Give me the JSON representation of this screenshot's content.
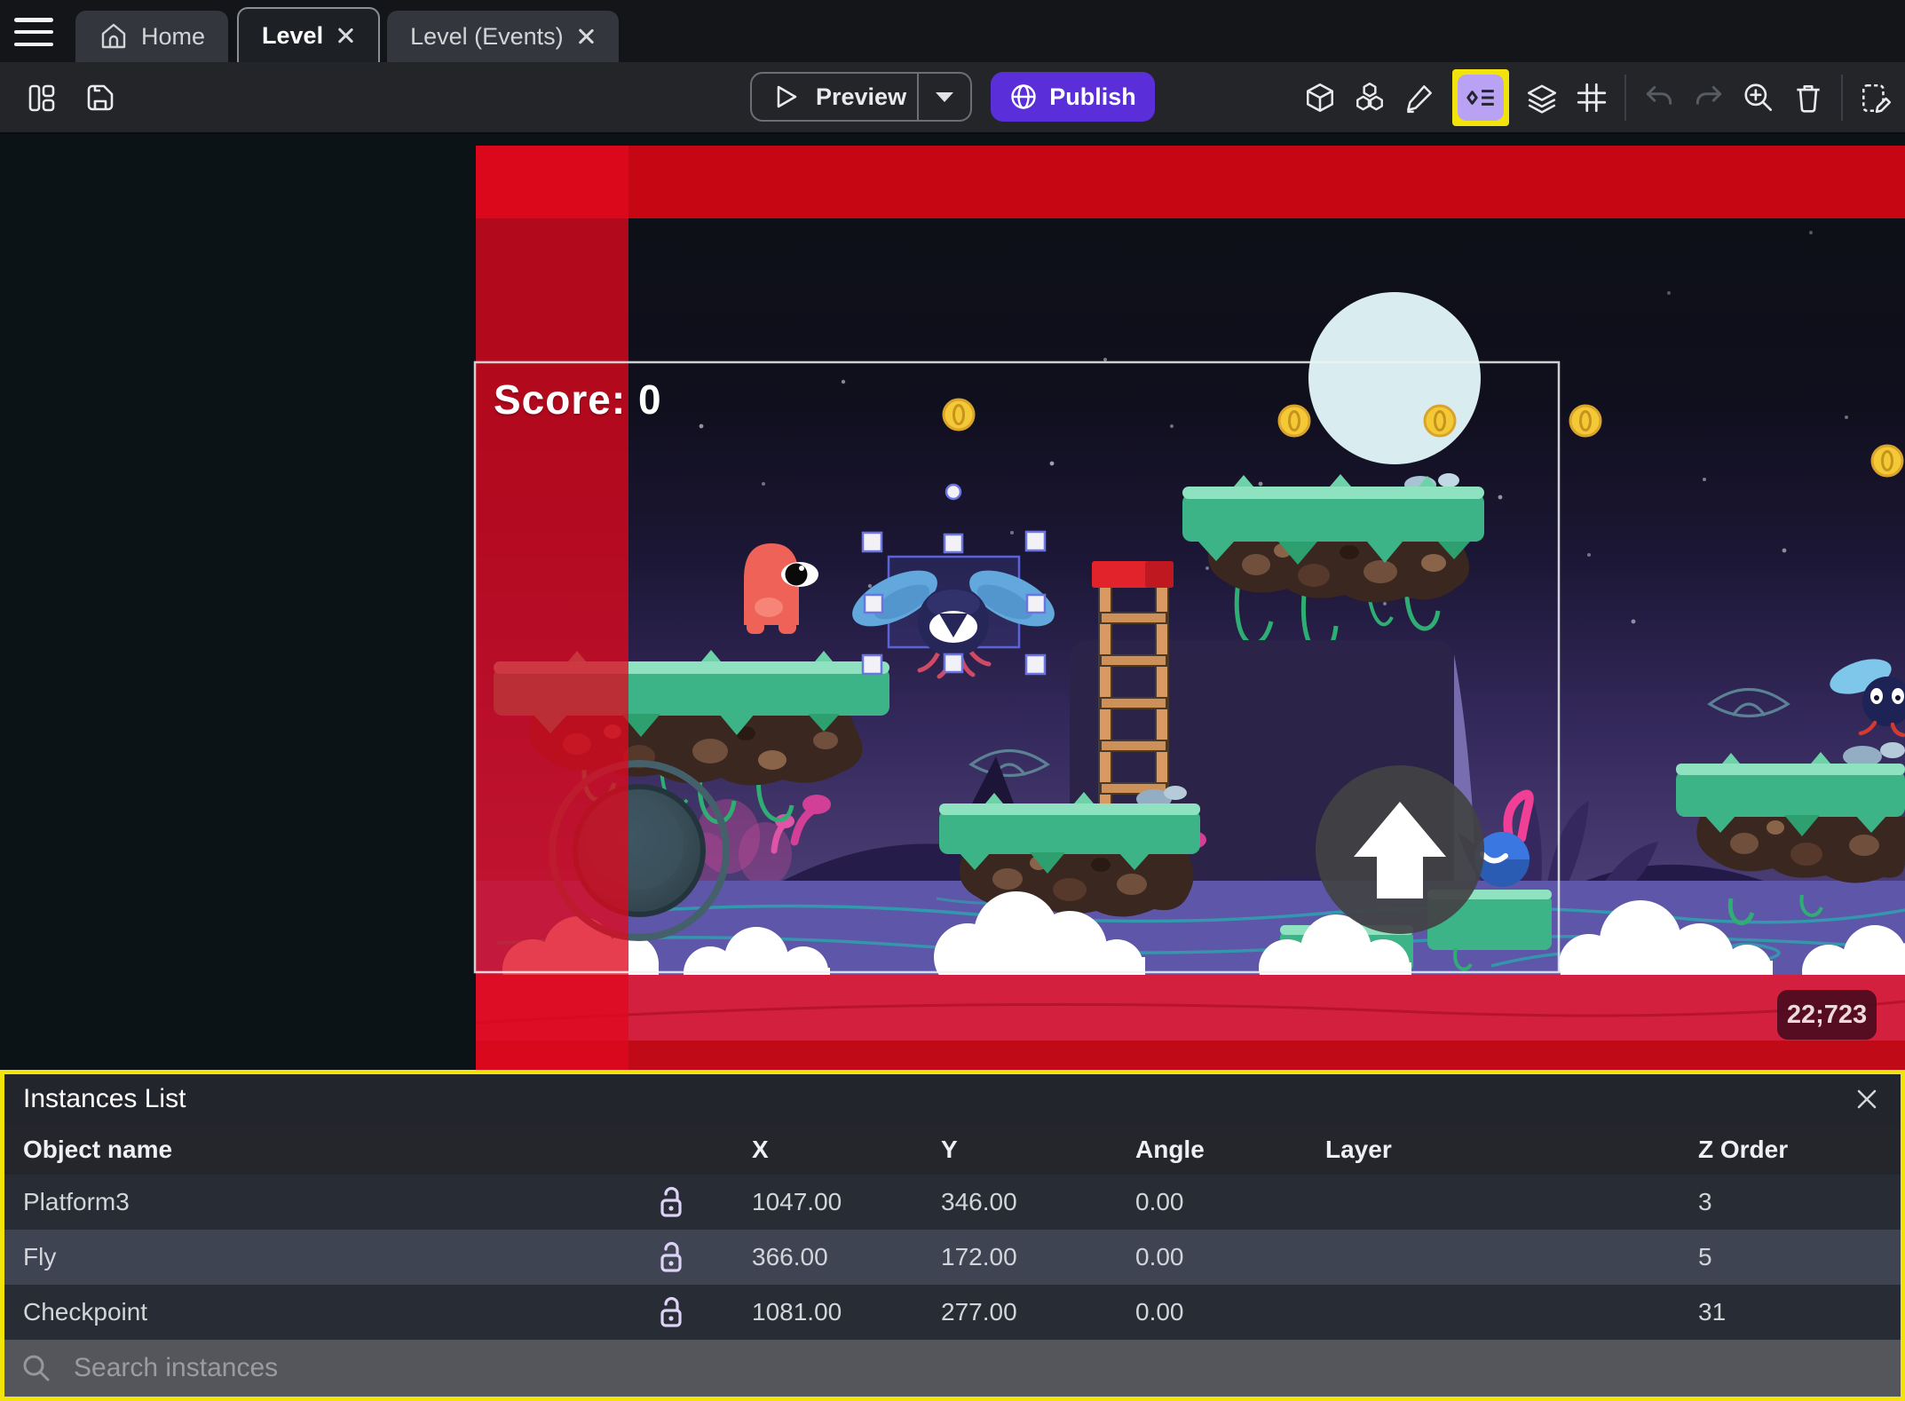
{
  "tabs": {
    "home": "Home",
    "level": "Level",
    "level_events": "Level (Events)"
  },
  "toolbar": {
    "preview_label": "Preview",
    "publish_label": "Publish",
    "left_icons": [
      "layout-icon",
      "save-icon"
    ],
    "right_icons": [
      "cube-3d-icon",
      "object-groups-icon",
      "edit-pencil-icon",
      "instances-list-icon",
      "layers-icon",
      "grid-icon",
      "undo-icon",
      "redo-icon",
      "zoom-in-icon",
      "trash-icon",
      "scene-properties-icon"
    ],
    "highlighted_icon": "instances-list-icon"
  },
  "canvas": {
    "score_text": "Score: 0",
    "coords_badge": "22;723"
  },
  "panel": {
    "title": "Instances List",
    "columns": [
      "Object name",
      "X",
      "Y",
      "Angle",
      "Layer",
      "Z Order"
    ],
    "rows": [
      {
        "name": "Platform3",
        "lock": "unlocked",
        "x": "1047.00",
        "y": "346.00",
        "angle": "0.00",
        "layer": "",
        "z": "3"
      },
      {
        "name": "Fly",
        "lock": "unlocked",
        "x": "366.00",
        "y": "172.00",
        "angle": "0.00",
        "layer": "",
        "z": "5"
      },
      {
        "name": "Checkpoint",
        "lock": "unlocked",
        "x": "1081.00",
        "y": "277.00",
        "angle": "0.00",
        "layer": "",
        "z": "31"
      }
    ],
    "search_placeholder": "Search instances"
  },
  "colors": {
    "highlight_yellow": "#f2e40a",
    "publish_purple": "#5a2fd9",
    "icon_active_bg": "#b9a2f4",
    "selected_row": "#3e4452",
    "red_stripe": "#e0081e",
    "red_band_top": "#c60613",
    "red_band_bottom": "#d3203f",
    "selection_blue": "#6b74e0",
    "coin_gold": "#f3c935",
    "moon": "#d9edf1"
  }
}
